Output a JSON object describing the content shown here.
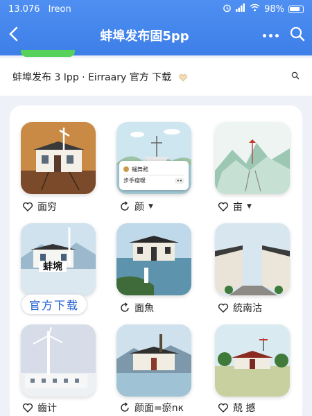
{
  "status": {
    "time": "13.076",
    "carrier": "Ireon",
    "battery": "98%"
  },
  "nav": {
    "title": "蚌埠发布固5pp"
  },
  "subheader": {
    "text": "蚌埠发布 3 Ipp · Eirraary 官方 下载"
  },
  "tiles": [
    {
      "caption": "面穷",
      "icon": "heart-outline-icon"
    },
    {
      "caption": "颜",
      "icon": "refresh-icon",
      "dropdown": true
    },
    {
      "caption": "亩",
      "icon": "heart-outline-icon",
      "dropdown": true
    },
    {
      "badge": "蚌埦",
      "icon": "heart-outline-icon"
    },
    {
      "caption": "面魚",
      "icon": "refresh-icon"
    },
    {
      "caption": "統南沽",
      "icon": "heart-outline-icon"
    },
    {
      "caption": "齒计",
      "icon": "heart-outline-icon"
    },
    {
      "caption": "颜面=瘀nк",
      "icon": "refresh-icon"
    },
    {
      "caption": "兢 撼",
      "icon": "heart-outline-icon"
    }
  ],
  "download_button": "官方下载",
  "popup": {
    "line1": "蛹舞甦",
    "line2": "步手瘤暖",
    "chip": "••"
  },
  "colors": {
    "accent": "#3d7fe8",
    "chip": "#56d15a",
    "button_text": "#1c5fd0"
  }
}
